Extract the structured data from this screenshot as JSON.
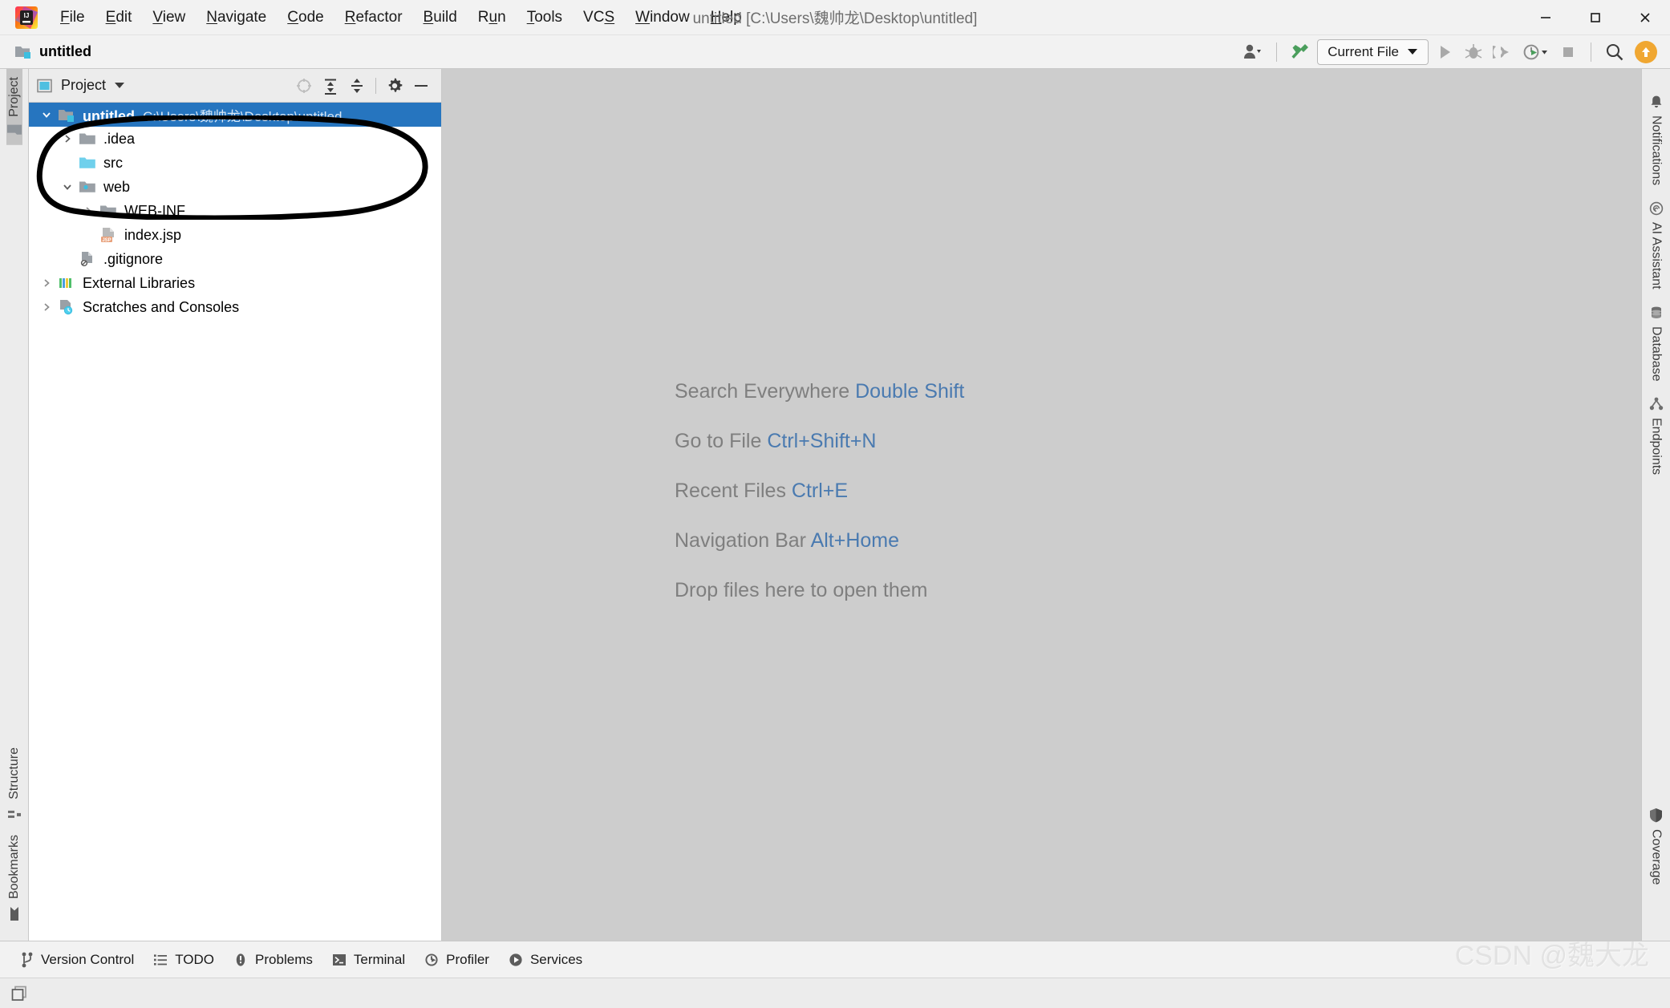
{
  "window": {
    "title": "untitled [C:\\Users\\魏帅龙\\Desktop\\untitled]",
    "minimize_label": "Minimize",
    "maximize_label": "Maximize",
    "close_label": "Close",
    "app_icon": "intellij-idea-logo"
  },
  "menu": {
    "items": [
      {
        "label": "File",
        "mnemonic": "F"
      },
      {
        "label": "Edit",
        "mnemonic": "E"
      },
      {
        "label": "View",
        "mnemonic": "V"
      },
      {
        "label": "Navigate",
        "mnemonic": "N"
      },
      {
        "label": "Code",
        "mnemonic": "C"
      },
      {
        "label": "Refactor",
        "mnemonic": "R"
      },
      {
        "label": "Build",
        "mnemonic": "B"
      },
      {
        "label": "Run",
        "mnemonic": "u"
      },
      {
        "label": "Tools",
        "mnemonic": "T"
      },
      {
        "label": "VCS",
        "mnemonic": "S"
      },
      {
        "label": "Window",
        "mnemonic": "W"
      },
      {
        "label": "Help",
        "mnemonic": "H"
      }
    ]
  },
  "navbar": {
    "breadcrumb": "untitled",
    "project_icon": "project-folder-icon"
  },
  "toolbar": {
    "account_label": "Account / IDE Services",
    "account_icon": "user-icon",
    "build_label": "Build Project",
    "build_icon": "hammer-icon",
    "run_config_label": "Current File",
    "run_label": "Run",
    "run_icon": "play-icon",
    "debug_label": "Debug",
    "debug_icon": "bug-icon",
    "run_coverage_label": "Run with Coverage",
    "run_coverage_icon": "coverage-run-icon",
    "profiler_label": "Profile",
    "profiler_icon": "profiler-icon",
    "stop_label": "Stop",
    "stop_icon": "stop-square-icon",
    "search_label": "Search Everywhere",
    "search_icon": "search-icon",
    "update_label": "Update Available",
    "update_icon": "arrow-up-circle-icon"
  },
  "left_strip": {
    "top": [
      {
        "label": "Project",
        "icon": "project-folder-icon",
        "selected": true
      }
    ],
    "bottom": [
      {
        "label": "Structure",
        "icon": "structure-icon",
        "selected": false
      },
      {
        "label": "Bookmarks",
        "icon": "bookmark-icon",
        "selected": false
      }
    ]
  },
  "right_strip": {
    "top": [
      {
        "label": "Notifications",
        "icon": "bell-icon"
      },
      {
        "label": "AI Assistant",
        "icon": "ai-assistant-icon"
      },
      {
        "label": "Database",
        "icon": "database-icon"
      },
      {
        "label": "Endpoints",
        "icon": "endpoints-icon"
      }
    ],
    "bottom": [
      {
        "label": "Coverage",
        "icon": "shield-icon"
      }
    ]
  },
  "project_panel": {
    "title": "Project",
    "title_icon": "project-view-icon",
    "dropdown_icon": "chevron-down-icon",
    "actions": [
      {
        "name": "select-opened-file",
        "label": "Select Opened File",
        "icon": "crosshair-icon",
        "disabled": true
      },
      {
        "name": "expand-all",
        "label": "Expand All",
        "icon": "expand-all-icon",
        "disabled": false
      },
      {
        "name": "collapse-all",
        "label": "Collapse All",
        "icon": "collapse-all-icon",
        "disabled": false
      },
      {
        "name": "options",
        "label": "Options",
        "icon": "gear-icon",
        "disabled": false
      },
      {
        "name": "hide",
        "label": "Hide",
        "icon": "minus-icon",
        "disabled": false
      }
    ],
    "tree": [
      {
        "label": "untitled",
        "path": "C:\\Users\\魏帅龙\\Desktop\\untitled",
        "icon": "project-root-icon",
        "indent": 0,
        "arrow": "down",
        "selected": true,
        "bold": true
      },
      {
        "label": ".idea",
        "path": "",
        "icon": "folder-gray-icon",
        "indent": 1,
        "arrow": "right",
        "selected": false,
        "bold": false
      },
      {
        "label": "src",
        "path": "",
        "icon": "folder-source-icon",
        "indent": 1,
        "arrow": "none",
        "selected": false,
        "bold": false
      },
      {
        "label": "web",
        "path": "",
        "icon": "folder-web-icon",
        "indent": 1,
        "arrow": "down",
        "selected": false,
        "bold": false
      },
      {
        "label": "WEB-INF",
        "path": "",
        "icon": "folder-gray-icon",
        "indent": 2,
        "arrow": "right",
        "selected": false,
        "bold": false
      },
      {
        "label": "index.jsp",
        "path": "",
        "icon": "jsp-file-icon",
        "indent": 2,
        "arrow": "none",
        "selected": false,
        "bold": false
      },
      {
        "label": ".gitignore",
        "path": "",
        "icon": "gitignore-file-icon",
        "indent": 1,
        "arrow": "none",
        "selected": false,
        "bold": false
      },
      {
        "label": "External Libraries",
        "path": "",
        "icon": "libraries-icon",
        "indent": 0,
        "arrow": "right",
        "selected": false,
        "bold": false
      },
      {
        "label": "Scratches and Consoles",
        "path": "",
        "icon": "scratches-icon",
        "indent": 0,
        "arrow": "right",
        "selected": false,
        "bold": false
      }
    ],
    "annotation": {
      "shape": "hand-drawn-ellipse",
      "color": "#000000",
      "encircles": [
        "web",
        "WEB-INF",
        "index.jsp",
        ".gitignore"
      ]
    }
  },
  "editor": {
    "background": "#cdcdcd",
    "hints": [
      {
        "text": "Search Everywhere",
        "key": "Double Shift"
      },
      {
        "text": "Go to File",
        "key": "Ctrl+Shift+N"
      },
      {
        "text": "Recent Files",
        "key": "Ctrl+E"
      },
      {
        "text": "Navigation Bar",
        "key": "Alt+Home"
      },
      {
        "text": "Drop files here to open them",
        "key": ""
      }
    ],
    "hint_color": "#7f7f7f",
    "key_color": "#4a7ab0"
  },
  "statusbar": {
    "items": [
      {
        "label": "Version Control",
        "icon": "branch-icon"
      },
      {
        "label": "TODO",
        "icon": "todo-list-icon"
      },
      {
        "label": "Problems",
        "icon": "problems-icon"
      },
      {
        "label": "Terminal",
        "icon": "terminal-icon"
      },
      {
        "label": "Profiler",
        "icon": "profiler-icon"
      },
      {
        "label": "Services",
        "icon": "services-icon"
      }
    ],
    "layout_icon": "layout-windows-icon",
    "layout_label": "Layout Settings"
  },
  "watermark": {
    "text": "CSDN @魏大龙"
  },
  "colors": {
    "accent_blue": "#2675bf",
    "editor_bg": "#cdcdcd",
    "chrome_bg": "#f2f2f2",
    "panel_bg": "#ffffff",
    "update_orange": "#f0a732",
    "jsp_orange": "#e8a07a"
  }
}
